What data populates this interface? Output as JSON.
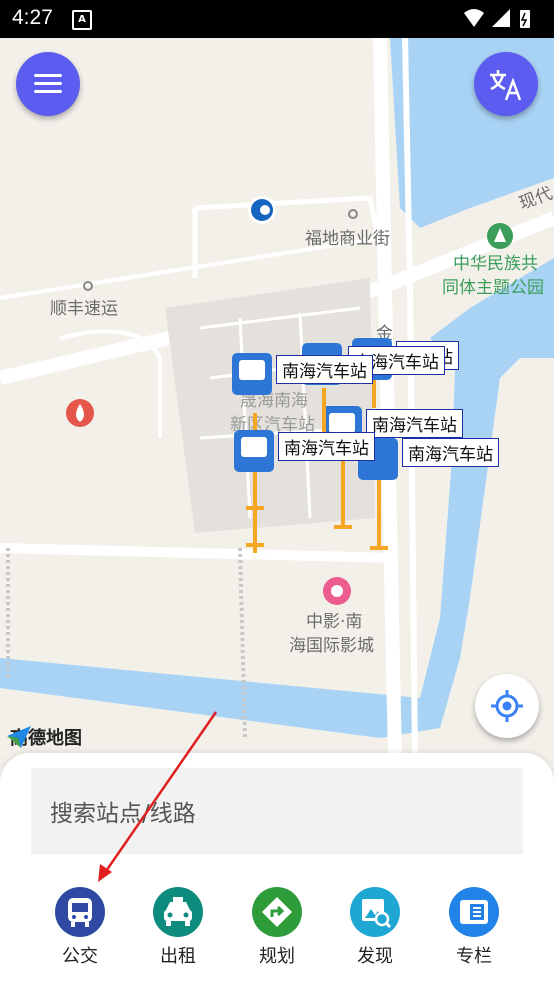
{
  "status_bar": {
    "time": "4:27",
    "notification_icon": "A"
  },
  "map": {
    "labels": {
      "fudi": "福地商业街",
      "shunfeng": "顺丰速运",
      "zhonghua_line1": "中华民族共",
      "zhonghua_line2": "同体主题公园",
      "xiandai": "现代",
      "jin": "金",
      "nanhai_area_line1": "晟海南海",
      "nanhai_area_line2": "新区汽车站",
      "cinema_line1": "中影·南",
      "cinema_line2": "海国际影城"
    },
    "station_labels": [
      "南海汽车站",
      "南海汽车站",
      "汽车站",
      "南海汽车站",
      "南海汽车站",
      "南海汽车站"
    ],
    "logo": "高德地图"
  },
  "search": {
    "placeholder": "搜索站点/线路"
  },
  "nav": {
    "bus": "公交",
    "taxi": "出租",
    "plan": "规划",
    "discover": "发现",
    "column": "专栏"
  },
  "colors": {
    "primary_purple": "#5c5cf0",
    "bus_blue": "#2e4aa3",
    "taxi_teal": "#0d8c7e",
    "plan_green": "#2f9c3c",
    "discover_cyan": "#1fa7d4",
    "column_blue": "#2183e8",
    "annotation_red": "#e02020"
  }
}
